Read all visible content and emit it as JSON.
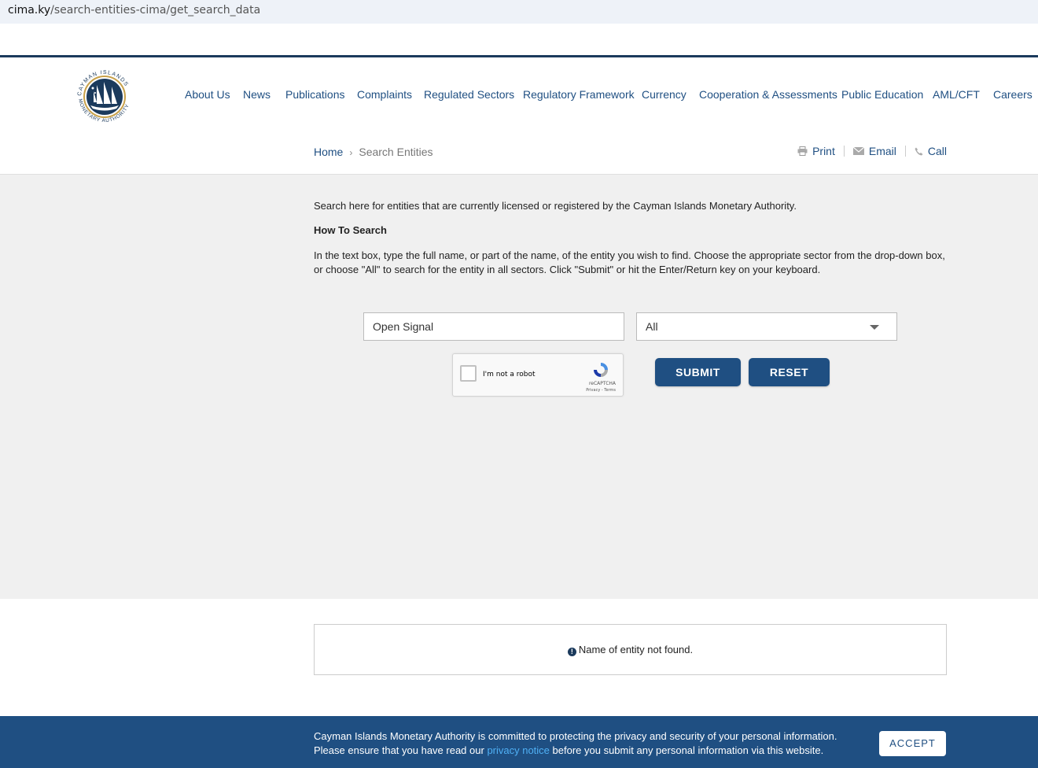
{
  "browser": {
    "url_domain": "cima.ky",
    "url_path": "/search-entities-cima/get_search_data"
  },
  "logo": {
    "text_top": "CAYMAN ISLANDS",
    "text_bottom": "MONETARY AUTHORITY"
  },
  "nav": {
    "items": [
      "About Us",
      "News",
      "Publications",
      "Complaints",
      "Regulated Sectors",
      "Regulatory Framework",
      "Currency",
      "Cooperation & Assessments",
      "Public Education",
      "AML/CFT",
      "Careers"
    ]
  },
  "breadcrumb": {
    "home": "Home",
    "separator": "›",
    "current": "Search Entities"
  },
  "tools": {
    "print": "Print",
    "email": "Email",
    "call": "Call"
  },
  "content": {
    "intro": "Search here for entities that are currently licensed or registered by the Cayman Islands Monetary Authority.",
    "howto_title": "How To Search",
    "instructions": "In the text box, type the full name, or part of the name, of the entity you wish to find. Choose the appropriate sector from the drop-down box, or choose \"All\" to search for the entity in all sectors. Click \"Submit\" or hit the Enter/Return key on your keyboard."
  },
  "search": {
    "value": "Open Signal",
    "sector_selected": "All"
  },
  "captcha": {
    "label": "I'm not a robot",
    "brand": "reCAPTCHA",
    "links": "Privacy - Terms"
  },
  "buttons": {
    "submit": "SUBMIT",
    "reset": "RESET"
  },
  "result": {
    "icon": "!",
    "message": "Name of entity not found."
  },
  "cookie": {
    "line1": "Cayman Islands Monetary Authority is committed to protecting the privacy and security of your personal information.",
    "line2_before": "Please ensure that you have read our ",
    "link": "privacy notice",
    "line2_after": " before you submit any personal information via this website.",
    "accept": "ACCEPT"
  },
  "colors": {
    "brand_blue": "#1f4f82",
    "dark_navy": "#1b3a5c",
    "link_light": "#4fb0f5"
  }
}
